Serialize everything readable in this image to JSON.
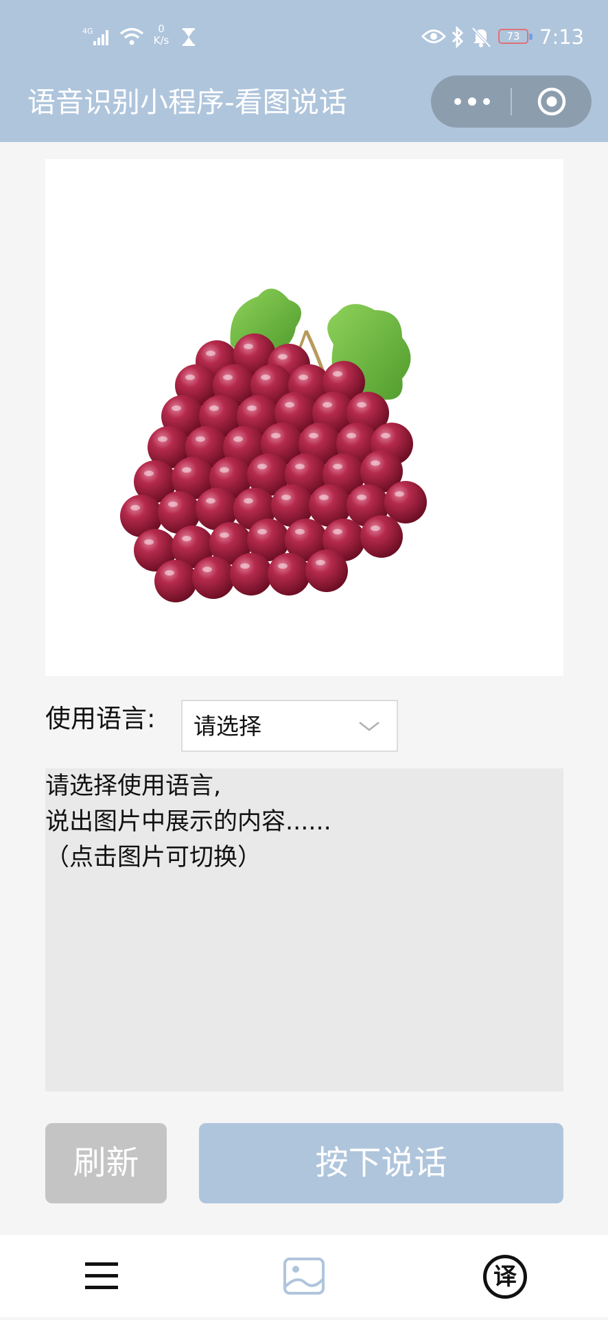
{
  "status_bar": {
    "network": "4G",
    "speed_value": "0",
    "speed_unit": "K/s",
    "battery": "73",
    "time": "7:13"
  },
  "header": {
    "title": "语音识别小程序-看图说话"
  },
  "language": {
    "label": "使用语言:",
    "selected": "请选择"
  },
  "prompt": {
    "lines": [
      "请选择使用语言,",
      "说出图片中展示的内容......",
      "（点击图片可切换）"
    ]
  },
  "actions": {
    "refresh_label": "刷新",
    "talk_label": "按下说话"
  },
  "bottom_nav": {
    "translate_glyph": "译"
  },
  "colors": {
    "header_bg": "#afc5dc",
    "primary_button": "#afc5dc",
    "secondary_button": "#c4c4c4",
    "prompt_bg": "#e9e9e9"
  },
  "icons": [
    "signal-icon",
    "wifi-icon",
    "hourglass-icon",
    "eye-icon",
    "bluetooth-icon",
    "bell-muted-icon",
    "battery-icon",
    "more-icon",
    "close-target-icon",
    "grape-image",
    "chevron-down-icon",
    "menu-icon",
    "image-icon",
    "translate-icon"
  ]
}
